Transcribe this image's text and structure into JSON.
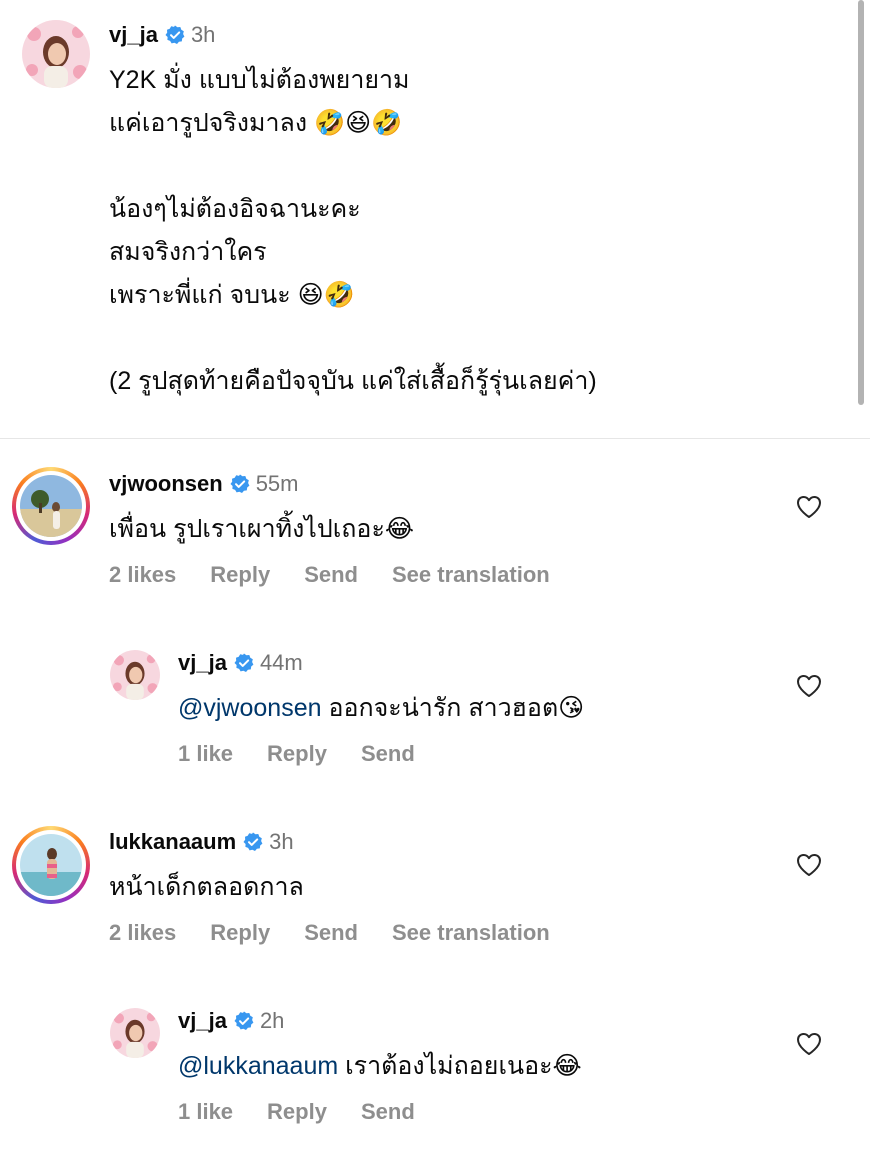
{
  "colors": {
    "verified": "#3897f0",
    "mention": "#00376b",
    "muted": "#737373",
    "action": "#8e8e8e"
  },
  "caption": {
    "user": "vj_ja",
    "time": "3h",
    "lines": [
      "Y2K มั่ง แบบไม่ต้องพยายาม",
      "แค่เอารูปจริงมาลง 🤣😆🤣",
      "",
      "น้องๆไม่ต้องอิจฉานะคะ",
      "สมจริงกว่าใคร",
      "เพราะพี่แก่ จบนะ 😆🤣",
      "",
      "(2 รูปสุดท้ายคือปัจจุบัน แค่ใส่เสื้อก็รู้รุ่นเลยค่า)"
    ]
  },
  "comments": [
    {
      "user": "vjwoonsen",
      "time": "55m",
      "mention": "",
      "text": "เพื่อน รูปเราเผาทิ้งไปเถอะ😂",
      "likes": "2 likes",
      "reply": "Reply",
      "send": "Send",
      "translate": "See translation"
    },
    {
      "user": "vj_ja",
      "time": "44m",
      "mention": "@vjwoonsen",
      "text": " ออกจะน่ารัก สาวฮอต😘",
      "likes": "1 like",
      "reply": "Reply",
      "send": "Send"
    },
    {
      "user": "lukkanaaum",
      "time": "3h",
      "mention": "",
      "text": "หน้าเด็กตลอดกาล",
      "likes": "2 likes",
      "reply": "Reply",
      "send": "Send",
      "translate": "See translation"
    },
    {
      "user": "vj_ja",
      "time": "2h",
      "mention": "@lukkanaaum",
      "text": " เราต้องไม่ถอยเนอะ😂",
      "likes": "1 like",
      "reply": "Reply",
      "send": "Send"
    }
  ]
}
